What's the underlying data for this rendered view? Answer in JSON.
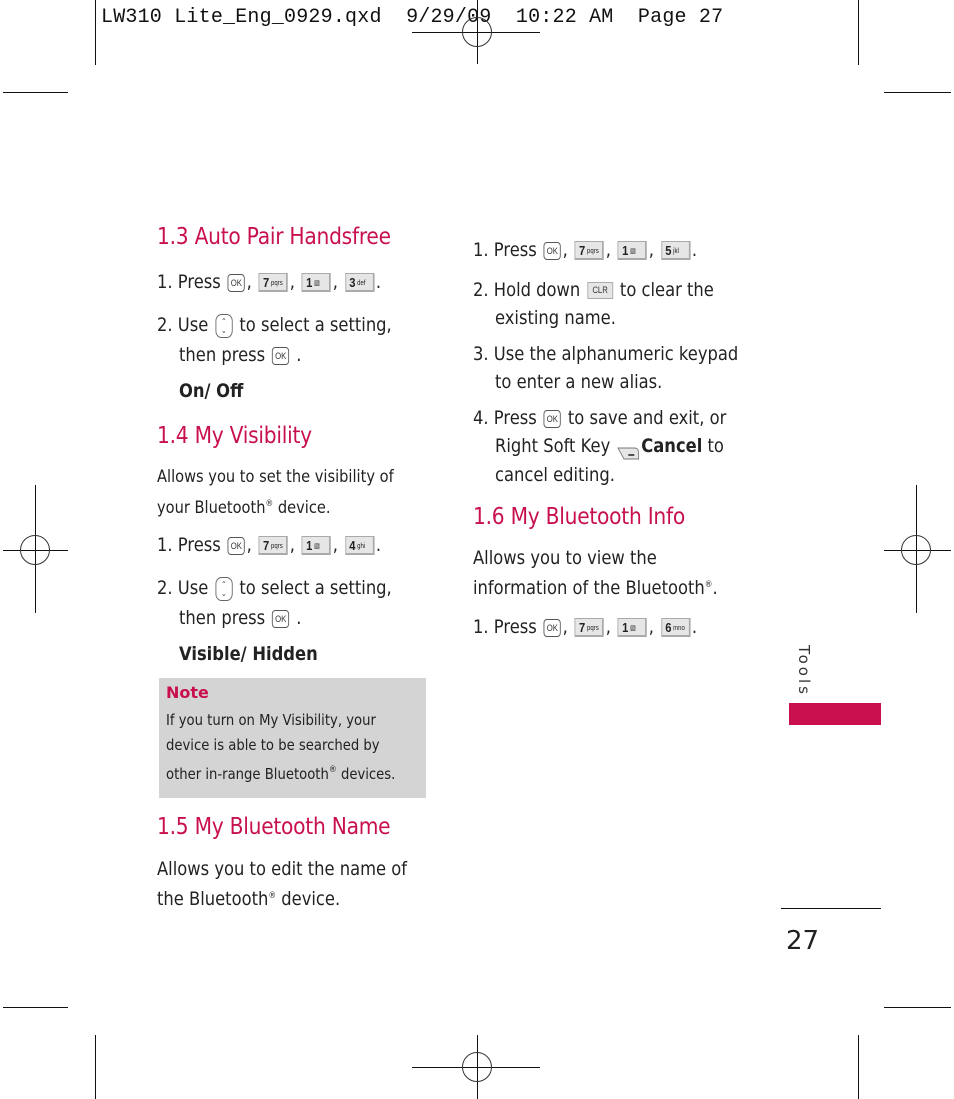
{
  "slug": {
    "file": "LW310 Lite_Eng_0929.qxd",
    "date": "9/29/09",
    "time": "10:22 AM",
    "page_label": "Page 27"
  },
  "accent_color": "#c8104e",
  "note_bg_color": "#d4d4d4",
  "keys": {
    "ok": "OK",
    "k7": {
      "digit": "7",
      "letters": "pqrs"
    },
    "k1": {
      "digit": "1",
      "letters": "voicemail-icon"
    },
    "k3": {
      "digit": "3",
      "letters": "def"
    },
    "k4": {
      "digit": "4",
      "letters": "ghi"
    },
    "k5": {
      "digit": "5",
      "letters": "jkl"
    },
    "k6": {
      "digit": "6",
      "letters": "mno"
    },
    "clr": "CLR",
    "nav": "up-down-nav-icon",
    "soft": "right-soft-key-icon"
  },
  "sections": {
    "s13": {
      "title": "1.3 Auto Pair Handsfree",
      "step1_prefix": "1. Press",
      "step2_a": "2. Use",
      "step2_b": "to select a setting,",
      "step2_c": "then press",
      "options": "On/ Off"
    },
    "s14": {
      "title": "1.4 My Visibility",
      "desc1": "Allows you to set the visibility of",
      "desc2a": "your Bluetooth",
      "desc2b": " device.",
      "step1_prefix": "1. Press",
      "step2_a": "2. Use",
      "step2_b": "to select a setting,",
      "step2_c": "then press",
      "options": "Visible/ Hidden"
    },
    "note": {
      "title": "Note",
      "line1": "If you turn on My Visibility, your",
      "line2": "device is able to be searched by",
      "line3a": "other in-range Bluetooth",
      "line3b": " devices."
    },
    "s15": {
      "title": "1.5 My Bluetooth Name",
      "desc1": "Allows you to edit the name of",
      "desc2a": "the Bluetooth",
      "desc2b": " device.",
      "step1_prefix": "1. Press",
      "step2_a": "2. Hold down",
      "step2_b": "to clear the",
      "step2_c": "existing name.",
      "step3_a": "3. Use the alphanumeric keypad",
      "step3_b": "to enter a new alias.",
      "step4_a": "4. Press",
      "step4_b": "to save and exit, or",
      "step4_c": "Right Soft Key",
      "step4_cancel": "Cancel",
      "step4_d": " to",
      "step4_e": "cancel editing."
    },
    "s16": {
      "title": "1.6 My Bluetooth Info",
      "desc1": "Allows you to view the",
      "desc2a": "information of the Bluetooth",
      "desc2b": ".",
      "step1_prefix": "1. Press"
    }
  },
  "registered_mark": "®",
  "side_tab": "Tools",
  "page_number": "27"
}
